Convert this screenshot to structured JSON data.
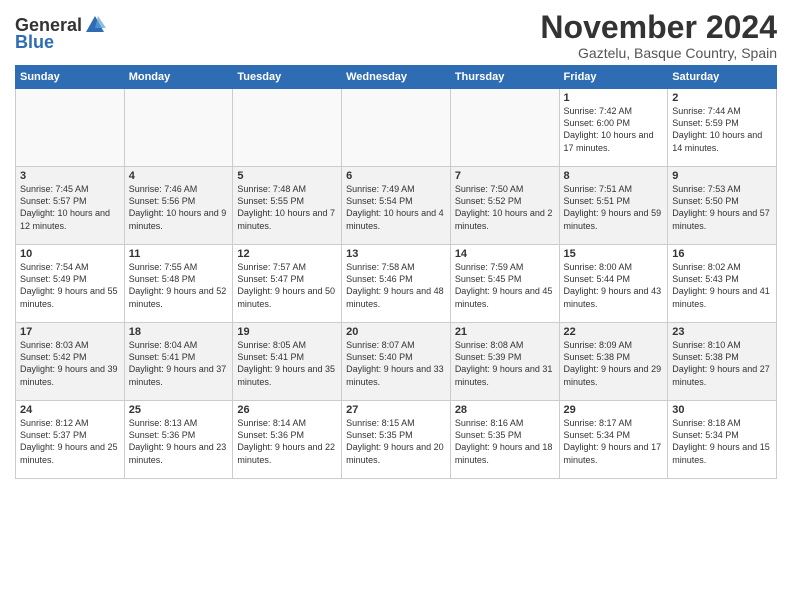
{
  "header": {
    "logo_general": "General",
    "logo_blue": "Blue",
    "title": "November 2024",
    "location": "Gaztelu, Basque Country, Spain"
  },
  "weekdays": [
    "Sunday",
    "Monday",
    "Tuesday",
    "Wednesday",
    "Thursday",
    "Friday",
    "Saturday"
  ],
  "weeks": [
    [
      {
        "day": "",
        "info": "",
        "empty": true
      },
      {
        "day": "",
        "info": "",
        "empty": true
      },
      {
        "day": "",
        "info": "",
        "empty": true
      },
      {
        "day": "",
        "info": "",
        "empty": true
      },
      {
        "day": "",
        "info": "",
        "empty": true
      },
      {
        "day": "1",
        "info": "Sunrise: 7:42 AM\nSunset: 6:00 PM\nDaylight: 10 hours and 17 minutes."
      },
      {
        "day": "2",
        "info": "Sunrise: 7:44 AM\nSunset: 5:59 PM\nDaylight: 10 hours and 14 minutes."
      }
    ],
    [
      {
        "day": "3",
        "info": "Sunrise: 7:45 AM\nSunset: 5:57 PM\nDaylight: 10 hours and 12 minutes."
      },
      {
        "day": "4",
        "info": "Sunrise: 7:46 AM\nSunset: 5:56 PM\nDaylight: 10 hours and 9 minutes."
      },
      {
        "day": "5",
        "info": "Sunrise: 7:48 AM\nSunset: 5:55 PM\nDaylight: 10 hours and 7 minutes."
      },
      {
        "day": "6",
        "info": "Sunrise: 7:49 AM\nSunset: 5:54 PM\nDaylight: 10 hours and 4 minutes."
      },
      {
        "day": "7",
        "info": "Sunrise: 7:50 AM\nSunset: 5:52 PM\nDaylight: 10 hours and 2 minutes."
      },
      {
        "day": "8",
        "info": "Sunrise: 7:51 AM\nSunset: 5:51 PM\nDaylight: 9 hours and 59 minutes."
      },
      {
        "day": "9",
        "info": "Sunrise: 7:53 AM\nSunset: 5:50 PM\nDaylight: 9 hours and 57 minutes."
      }
    ],
    [
      {
        "day": "10",
        "info": "Sunrise: 7:54 AM\nSunset: 5:49 PM\nDaylight: 9 hours and 55 minutes."
      },
      {
        "day": "11",
        "info": "Sunrise: 7:55 AM\nSunset: 5:48 PM\nDaylight: 9 hours and 52 minutes."
      },
      {
        "day": "12",
        "info": "Sunrise: 7:57 AM\nSunset: 5:47 PM\nDaylight: 9 hours and 50 minutes."
      },
      {
        "day": "13",
        "info": "Sunrise: 7:58 AM\nSunset: 5:46 PM\nDaylight: 9 hours and 48 minutes."
      },
      {
        "day": "14",
        "info": "Sunrise: 7:59 AM\nSunset: 5:45 PM\nDaylight: 9 hours and 45 minutes."
      },
      {
        "day": "15",
        "info": "Sunrise: 8:00 AM\nSunset: 5:44 PM\nDaylight: 9 hours and 43 minutes."
      },
      {
        "day": "16",
        "info": "Sunrise: 8:02 AM\nSunset: 5:43 PM\nDaylight: 9 hours and 41 minutes."
      }
    ],
    [
      {
        "day": "17",
        "info": "Sunrise: 8:03 AM\nSunset: 5:42 PM\nDaylight: 9 hours and 39 minutes."
      },
      {
        "day": "18",
        "info": "Sunrise: 8:04 AM\nSunset: 5:41 PM\nDaylight: 9 hours and 37 minutes."
      },
      {
        "day": "19",
        "info": "Sunrise: 8:05 AM\nSunset: 5:41 PM\nDaylight: 9 hours and 35 minutes."
      },
      {
        "day": "20",
        "info": "Sunrise: 8:07 AM\nSunset: 5:40 PM\nDaylight: 9 hours and 33 minutes."
      },
      {
        "day": "21",
        "info": "Sunrise: 8:08 AM\nSunset: 5:39 PM\nDaylight: 9 hours and 31 minutes."
      },
      {
        "day": "22",
        "info": "Sunrise: 8:09 AM\nSunset: 5:38 PM\nDaylight: 9 hours and 29 minutes."
      },
      {
        "day": "23",
        "info": "Sunrise: 8:10 AM\nSunset: 5:38 PM\nDaylight: 9 hours and 27 minutes."
      }
    ],
    [
      {
        "day": "24",
        "info": "Sunrise: 8:12 AM\nSunset: 5:37 PM\nDaylight: 9 hours and 25 minutes."
      },
      {
        "day": "25",
        "info": "Sunrise: 8:13 AM\nSunset: 5:36 PM\nDaylight: 9 hours and 23 minutes."
      },
      {
        "day": "26",
        "info": "Sunrise: 8:14 AM\nSunset: 5:36 PM\nDaylight: 9 hours and 22 minutes."
      },
      {
        "day": "27",
        "info": "Sunrise: 8:15 AM\nSunset: 5:35 PM\nDaylight: 9 hours and 20 minutes."
      },
      {
        "day": "28",
        "info": "Sunrise: 8:16 AM\nSunset: 5:35 PM\nDaylight: 9 hours and 18 minutes."
      },
      {
        "day": "29",
        "info": "Sunrise: 8:17 AM\nSunset: 5:34 PM\nDaylight: 9 hours and 17 minutes."
      },
      {
        "day": "30",
        "info": "Sunrise: 8:18 AM\nSunset: 5:34 PM\nDaylight: 9 hours and 15 minutes."
      }
    ]
  ]
}
